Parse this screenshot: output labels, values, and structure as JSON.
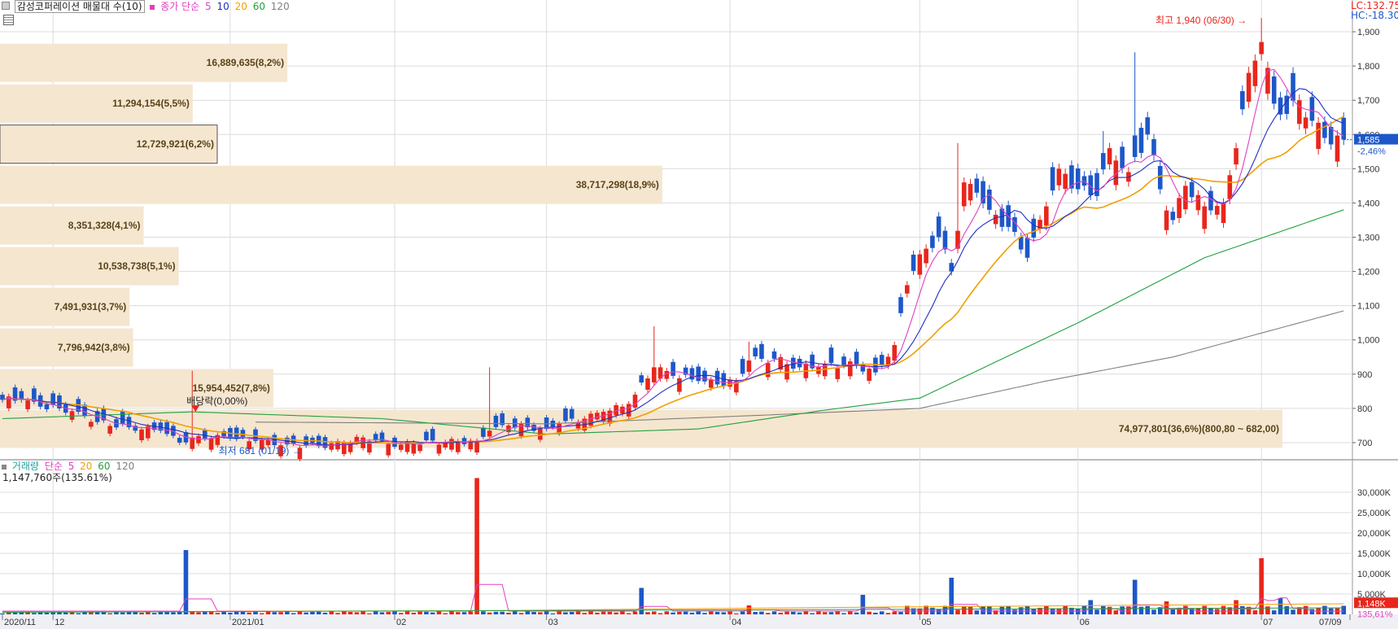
{
  "header": {
    "price_title": "감성코퍼레이션 매물대 수(10)",
    "ma_label": "종가 단순",
    "ma_periods": [
      "5",
      "10",
      "20",
      "60",
      "120"
    ],
    "lc": "LC:132.75",
    "hc": "HC:-18.30"
  },
  "volume_header": {
    "title": "거래량",
    "ma_label": "단순",
    "ma_periods": [
      "5",
      "20",
      "60",
      "120"
    ],
    "current": "1,147,760주(135.61%)"
  },
  "colors": {
    "up": "#e8261c",
    "down": "#1d57c9",
    "ma5": "#e040c0",
    "ma10": "#2030c0",
    "ma20": "#f0a000",
    "ma60": "#20a040",
    "ma120": "#808080",
    "profile": "#f5e6d0",
    "grid": "#dcdcdc"
  },
  "chart_data": {
    "type": "candlestick",
    "price_axis": {
      "min": 650,
      "max": 1950,
      "ticks": [
        700,
        800,
        900,
        1000,
        1100,
        1200,
        1300,
        1400,
        1500,
        1600,
        1700,
        1800,
        1900
      ]
    },
    "volume_axis": {
      "min": 0,
      "max": 36000,
      "ticks": [
        5000,
        10000,
        15000,
        20000,
        25000,
        30000
      ],
      "tick_labels": [
        "5,000K",
        "10,000K",
        "15,000K",
        "20,000K",
        "25,000K",
        "30,000K"
      ]
    },
    "x_labels": [
      {
        "label": "2020/11",
        "index": 0
      },
      {
        "label": "12",
        "index": 8
      },
      {
        "label": "2021/01",
        "index": 36
      },
      {
        "label": "02",
        "index": 62
      },
      {
        "label": "03",
        "index": 86
      },
      {
        "label": "04",
        "index": 115
      },
      {
        "label": "05",
        "index": 145
      },
      {
        "label": "06",
        "index": 170
      },
      {
        "label": "07",
        "index": 199
      },
      {
        "label": "07/09",
        "index": 213
      }
    ],
    "candles": {
      "n": 213,
      "anchors": [
        [
          0,
          825,
          "d"
        ],
        [
          3,
          825,
          "d"
        ],
        [
          6,
          805,
          "d"
        ],
        [
          9,
          800,
          "d"
        ],
        [
          12,
          790,
          "d"
        ],
        [
          15,
          760,
          "d"
        ],
        [
          20,
          745,
          "d"
        ],
        [
          25,
          735,
          "d"
        ],
        [
          28,
          700,
          "d"
        ],
        [
          30,
          715,
          "u"
        ],
        [
          32,
          712,
          "d"
        ],
        [
          34,
          722,
          "u"
        ],
        [
          36,
          712,
          "d"
        ],
        [
          40,
          705,
          "d"
        ],
        [
          45,
          695,
          "d"
        ],
        [
          50,
          690,
          "d"
        ],
        [
          54,
          700,
          "u"
        ],
        [
          57,
          715,
          "u"
        ],
        [
          60,
          705,
          "d"
        ],
        [
          62,
          688,
          "d"
        ],
        [
          65,
          700,
          "u"
        ],
        [
          70,
          702,
          "u"
        ],
        [
          75,
          705,
          "u"
        ],
        [
          77,
          735,
          "u"
        ],
        [
          80,
          750,
          "u"
        ],
        [
          83,
          745,
          "d"
        ],
        [
          86,
          740,
          "d"
        ],
        [
          88,
          755,
          "u"
        ],
        [
          92,
          770,
          "u"
        ],
        [
          95,
          790,
          "u"
        ],
        [
          98,
          805,
          "u"
        ],
        [
          100,
          840,
          "u"
        ],
        [
          103,
          920,
          "u"
        ],
        [
          106,
          895,
          "d"
        ],
        [
          110,
          880,
          "d"
        ],
        [
          113,
          870,
          "d"
        ],
        [
          116,
          880,
          "u"
        ],
        [
          118,
          940,
          "u"
        ],
        [
          122,
          945,
          "d"
        ],
        [
          126,
          920,
          "d"
        ],
        [
          130,
          930,
          "u"
        ],
        [
          135,
          925,
          "d"
        ],
        [
          138,
          905,
          "d"
        ],
        [
          141,
          985,
          "u"
        ],
        [
          143,
          1160,
          "u"
        ],
        [
          145,
          1250,
          "u"
        ],
        [
          148,
          1300,
          "d"
        ],
        [
          150,
          1200,
          "d"
        ],
        [
          152,
          1460,
          "u"
        ],
        [
          154,
          1430,
          "d"
        ],
        [
          156,
          1380,
          "d"
        ],
        [
          159,
          1330,
          "d"
        ],
        [
          162,
          1240,
          "d"
        ],
        [
          165,
          1390,
          "u"
        ],
        [
          167,
          1500,
          "u"
        ],
        [
          170,
          1440,
          "d"
        ],
        [
          173,
          1420,
          "d"
        ],
        [
          175,
          1560,
          "u"
        ],
        [
          178,
          1490,
          "u"
        ],
        [
          181,
          1600,
          "d"
        ],
        [
          183,
          1440,
          "d"
        ],
        [
          185,
          1350,
          "d"
        ],
        [
          187,
          1450,
          "u"
        ],
        [
          190,
          1390,
          "u"
        ],
        [
          193,
          1400,
          "u"
        ],
        [
          195,
          1560,
          "u"
        ],
        [
          197,
          1780,
          "u"
        ],
        [
          199,
          1870,
          "u"
        ],
        [
          201,
          1690,
          "d"
        ],
        [
          203,
          1660,
          "d"
        ],
        [
          205,
          1700,
          "u"
        ],
        [
          207,
          1640,
          "d"
        ],
        [
          209,
          1590,
          "d"
        ],
        [
          212,
          1585,
          "d"
        ]
      ],
      "spike_highs": [
        [
          30,
          910
        ],
        [
          77,
          920
        ],
        [
          103,
          1040
        ],
        [
          118,
          995
        ],
        [
          151,
          1575
        ],
        [
          174,
          1610
        ],
        [
          179,
          1840
        ],
        [
          199,
          1940
        ]
      ],
      "low": {
        "index": 46,
        "value": 681
      },
      "high": {
        "index": 199,
        "value": 1940
      }
    },
    "volume_spikes": [
      [
        29,
        15800
      ],
      [
        75,
        33500
      ],
      [
        101,
        6500
      ],
      [
        118,
        2200
      ],
      [
        136,
        4800
      ],
      [
        150,
        9000
      ],
      [
        172,
        3500
      ],
      [
        179,
        8500
      ],
      [
        184,
        3200
      ],
      [
        195,
        3500
      ],
      [
        199,
        13800
      ],
      [
        202,
        4000
      ]
    ],
    "moving_averages": {
      "ma5": {
        "period": 5,
        "start": [
          0,
          820
        ],
        "end": [
          212,
          1640
        ]
      },
      "ma10": {
        "period": 10,
        "start": [
          0,
          815
        ],
        "end": [
          212,
          1700
        ]
      },
      "ma20": {
        "period": 20,
        "start": [
          0,
          810
        ],
        "end": [
          212,
          1565
        ]
      },
      "ma60": {
        "period": 60,
        "values": [
          [
            0,
            770
          ],
          [
            30,
            790
          ],
          [
            60,
            770
          ],
          [
            86,
            725
          ],
          [
            110,
            740
          ],
          [
            130,
            795
          ],
          [
            145,
            830
          ],
          [
            170,
            1050
          ],
          [
            190,
            1240
          ],
          [
            212,
            1380
          ]
        ]
      },
      "ma120": {
        "period": 120,
        "values": [
          [
            40,
            760
          ],
          [
            86,
            755
          ],
          [
            120,
            780
          ],
          [
            145,
            800
          ],
          [
            165,
            880
          ],
          [
            185,
            950
          ],
          [
            212,
            1085
          ]
        ]
      }
    },
    "volume_profile": [
      {
        "label": "74,977,801(36,6%)(800,80 ~ 682,00)",
        "pct": 36.6,
        "band": [
          682,
          800.8
        ]
      },
      {
        "label": "15,954,452(7,8%)",
        "pct": 7.8,
        "band": [
          800.8,
          919.6
        ]
      },
      {
        "label": "7,796,942(3,8%)",
        "pct": 3.8,
        "band": [
          919.6,
          1038.4
        ]
      },
      {
        "label": "7,491,931(3,7%)",
        "pct": 3.7,
        "band": [
          1038.4,
          1157.2
        ]
      },
      {
        "label": "10,538,738(5,1%)",
        "pct": 5.1,
        "band": [
          1157.2,
          1276
        ]
      },
      {
        "label": "8,351,328(4,1%)",
        "pct": 4.1,
        "band": [
          1276,
          1394.8
        ]
      },
      {
        "label": "38,717,298(18,9%)",
        "pct": 18.9,
        "band": [
          1394.8,
          1513.6
        ]
      },
      {
        "label": "12,729,921(6,2%)",
        "pct": 6.2,
        "band": [
          1513.6,
          1632.4
        ],
        "current": true
      },
      {
        "label": "11,294,154(5,5%)",
        "pct": 5.5,
        "band": [
          1632.4,
          1751.2
        ]
      },
      {
        "label": "16,889,635(8,2%)",
        "pct": 8.2,
        "band": [
          1751.2,
          1870
        ]
      }
    ],
    "annotations": {
      "high_label": "최고 1,940 (06/30)",
      "low_label": "최저 681 (01/19)",
      "dividend_label": "배당락(0,00%)",
      "dividend_index": 30,
      "current_price": {
        "value": 1585,
        "label": "1,585",
        "change": "-2,46%"
      },
      "current_volume": {
        "value": 1148,
        "label": "1,148K",
        "pct": "135,61%"
      }
    }
  }
}
